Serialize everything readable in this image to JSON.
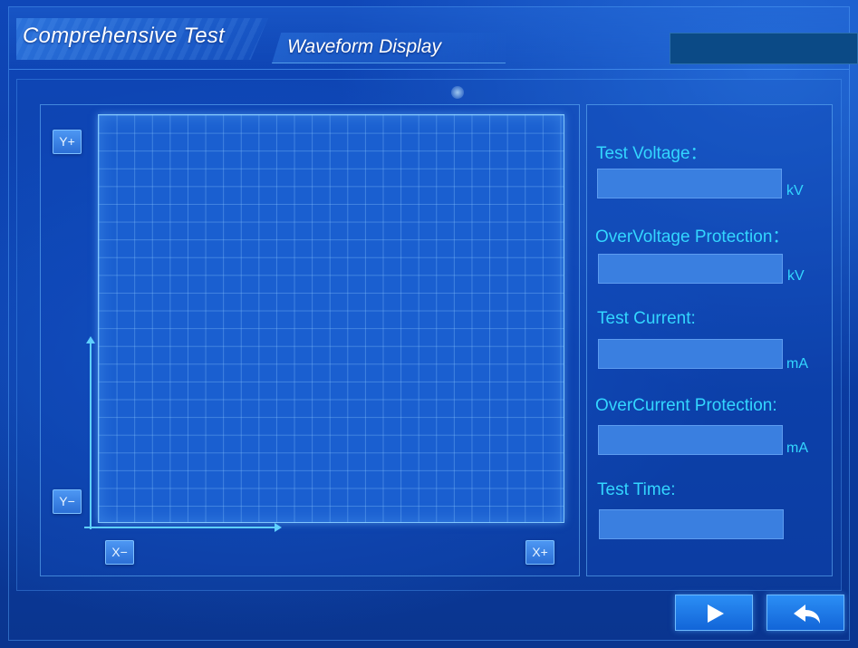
{
  "header": {
    "main_tab": "Comprehensive Test",
    "sub_tab": "Waveform Display"
  },
  "plot": {
    "buttons": {
      "y_plus": "Y+",
      "y_minus": "Y−",
      "x_minus": "X−",
      "x_plus": "X+"
    }
  },
  "readouts": {
    "test_voltage": {
      "label": "Test Voltage：",
      "value": "",
      "unit": "kV"
    },
    "overvoltage_protection": {
      "label": "OverVoltage Protection：",
      "value": "",
      "unit": "kV"
    },
    "test_current": {
      "label": "Test Current:",
      "value": "",
      "unit": "mA"
    },
    "overcurrent_protection": {
      "label": "OverCurrent Protection:",
      "value": "",
      "unit": "mA"
    },
    "test_time": {
      "label": "Test Time:",
      "value": ""
    }
  },
  "footer": {
    "next_icon": "play-icon",
    "back_icon": "return-arrow-icon"
  },
  "colors": {
    "background": "#0b3da7",
    "label_cyan": "#33d6ff",
    "field_fill": "#3a7fe0",
    "button_fill": "#1265d8"
  }
}
